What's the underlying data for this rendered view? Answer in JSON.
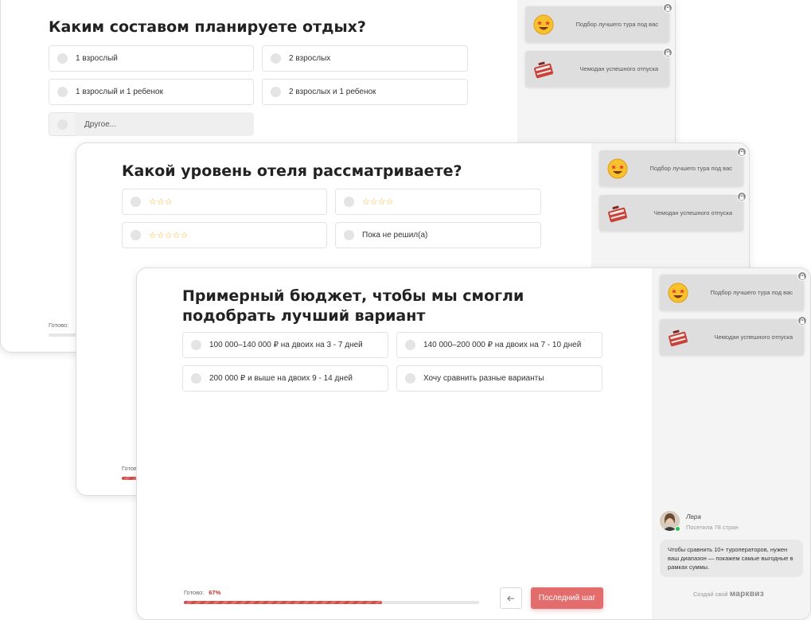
{
  "icons": {
    "bonus_1": "star-struck-emoji-icon",
    "bonus_2": "suitcase-icon",
    "lock": "lock-icon",
    "back": "arrow-left-icon"
  },
  "colors": {
    "accent": "#e26d6c",
    "progress_text": "#c4302b",
    "star": "#f3b31f",
    "online": "#27c24c"
  },
  "step1": {
    "question": "Каким составом планируете отдых?",
    "options": [
      "1 взрослый",
      "2 взрослых",
      "1 взрослый и 1 ребенок",
      "2 взрослых и 1 ребенок"
    ],
    "other_placeholder": "Другое...",
    "progress_label": "Готово:"
  },
  "step2": {
    "question": "Какой уровень отеля рассматриваете?",
    "options": [
      {
        "stars": "☆☆☆",
        "label": ""
      },
      {
        "stars": "☆☆☆☆",
        "label": ""
      },
      {
        "stars": "☆☆☆☆☆",
        "label": ""
      },
      {
        "stars": "",
        "label": "Пока не решил(а)"
      }
    ],
    "progress_label": "Готово:"
  },
  "step3": {
    "question": "Примерный бюджет, чтобы мы смогли подобрать лучший вариант",
    "options": [
      "100 000–140 000 ₽ на двоих на 3 - 7 дней",
      "140 000–200 000 ₽ на двоих на 7 - 10 дней",
      "200 000 ₽ и выше на двоих 9 - 14 дней",
      "Хочу сравнить разные варианты"
    ],
    "progress_label": "Готово:",
    "progress_value": "67%",
    "progress_fraction": 0.67,
    "next_button": "Последний шаг"
  },
  "bonuses": [
    "Подбор лучшего тура под вас",
    "Чемодан успешного отпуска"
  ],
  "consultant": {
    "name": "Лера",
    "subtitle": "Посетила 78 стран",
    "message": "Чтобы сравнить 10+ туроператоров, нужен ваш диапазон — покажем самые выгодные в рамках суммы."
  },
  "brand": {
    "prefix": "Создай свой",
    "name": "марквиз"
  }
}
